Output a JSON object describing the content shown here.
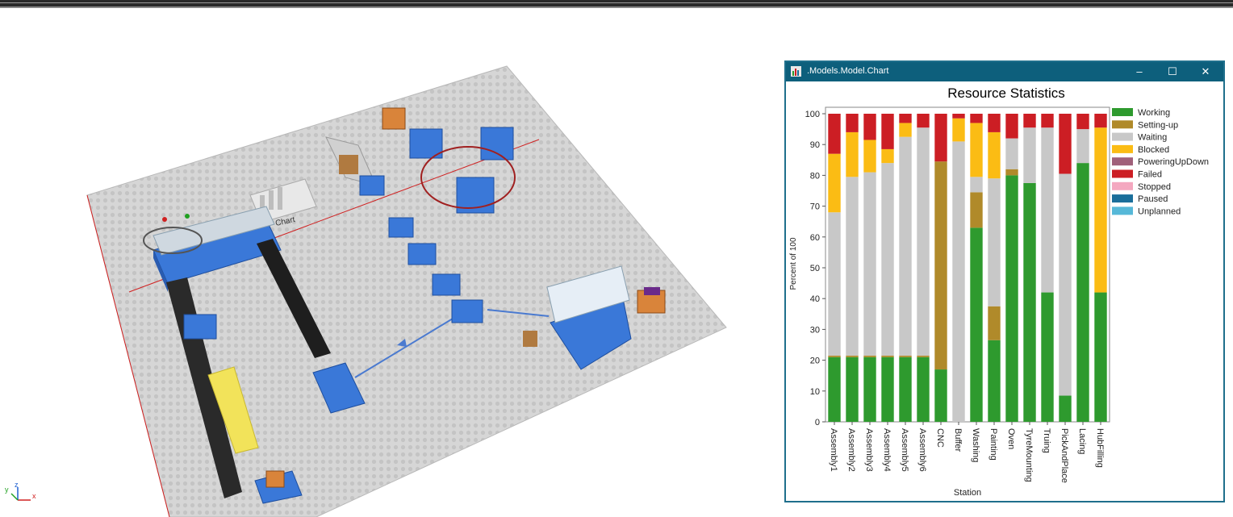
{
  "window": {
    "title": ".Models.Model.Chart",
    "minimize_glyph": "–",
    "maximize_glyph": "☐",
    "close_glyph": "✕",
    "icon": "chart-app-icon"
  },
  "scene": {
    "chart_sign_label": "Chart",
    "gizmo": {
      "x": "x",
      "y": "y",
      "z": "z"
    }
  },
  "colors": {
    "titlebar": "#0d5f7c",
    "window_border": "#1f6f8c",
    "floor": "#d3d3d3",
    "station_blue": "#3a78d8",
    "yellow_conveyor": "#f2e35a",
    "red_axis": "#d02020"
  },
  "chart_data": {
    "type": "bar",
    "stacked": true,
    "title": "Resource Statistics",
    "xlabel": "Station",
    "ylabel": "Percent of 100",
    "ylim": [
      0,
      100
    ],
    "yticks": [
      0,
      10,
      20,
      30,
      40,
      50,
      60,
      70,
      80,
      90,
      100
    ],
    "grid": false,
    "legend_position": "right",
    "categories": [
      "Assembly1",
      "Assembly2",
      "Assembly3",
      "Assembly4",
      "Assembly5",
      "Assembly6",
      "CNC",
      "Buffer",
      "Washing",
      "Painting",
      "Oven",
      "TyreMounting",
      "Truing",
      "PickAndPlace",
      "Lacing",
      "HubFilling"
    ],
    "series": [
      {
        "name": "Working",
        "color": "#2e9a2e",
        "values": [
          21,
          21,
          21,
          21,
          21,
          21,
          17,
          0,
          63,
          26.5,
          80,
          77.5,
          42,
          8.5,
          84,
          42
        ]
      },
      {
        "name": "Setting-up",
        "color": "#b08a2a",
        "values": [
          0.5,
          0.5,
          0.5,
          0.5,
          0.5,
          0.5,
          67.5,
          0,
          11.5,
          11,
          2,
          0,
          0,
          0,
          0,
          0
        ]
      },
      {
        "name": "Waiting",
        "color": "#c8c8c8",
        "values": [
          46.5,
          58,
          59.5,
          62.5,
          71,
          74,
          0,
          91,
          5,
          41.5,
          10,
          18,
          53.5,
          72,
          11,
          0
        ]
      },
      {
        "name": "Blocked",
        "color": "#fbbc14",
        "values": [
          19,
          14.5,
          10.5,
          4.5,
          4.5,
          0,
          0,
          7.5,
          17.5,
          15,
          0,
          0,
          0,
          0,
          0,
          53.5
        ]
      },
      {
        "name": "PoweringUpDown",
        "color": "#a0607a",
        "values": [
          0,
          0,
          0,
          0,
          0,
          0,
          0,
          0,
          0,
          0,
          0,
          0,
          0,
          0,
          0,
          0
        ]
      },
      {
        "name": "Failed",
        "color": "#cc1e24",
        "values": [
          13,
          6,
          8.5,
          11.5,
          3,
          4.5,
          15.5,
          1.5,
          3,
          6,
          8,
          4.5,
          4.5,
          19.5,
          5,
          4.5
        ]
      },
      {
        "name": "Stopped",
        "color": "#f4a8c0",
        "values": [
          0,
          0,
          0,
          0,
          0,
          0,
          0,
          0,
          0,
          0,
          0,
          0,
          0,
          0,
          0,
          0
        ]
      },
      {
        "name": "Paused",
        "color": "#1a6e9a",
        "values": [
          0,
          0,
          0,
          0,
          0,
          0,
          0,
          0,
          0,
          0,
          0,
          0,
          0,
          0,
          0,
          0
        ]
      },
      {
        "name": "Unplanned",
        "color": "#56b8d8",
        "values": [
          0,
          0,
          0,
          0,
          0,
          0,
          0,
          0,
          0,
          0,
          0,
          0,
          0,
          0,
          0,
          0
        ]
      }
    ]
  }
}
